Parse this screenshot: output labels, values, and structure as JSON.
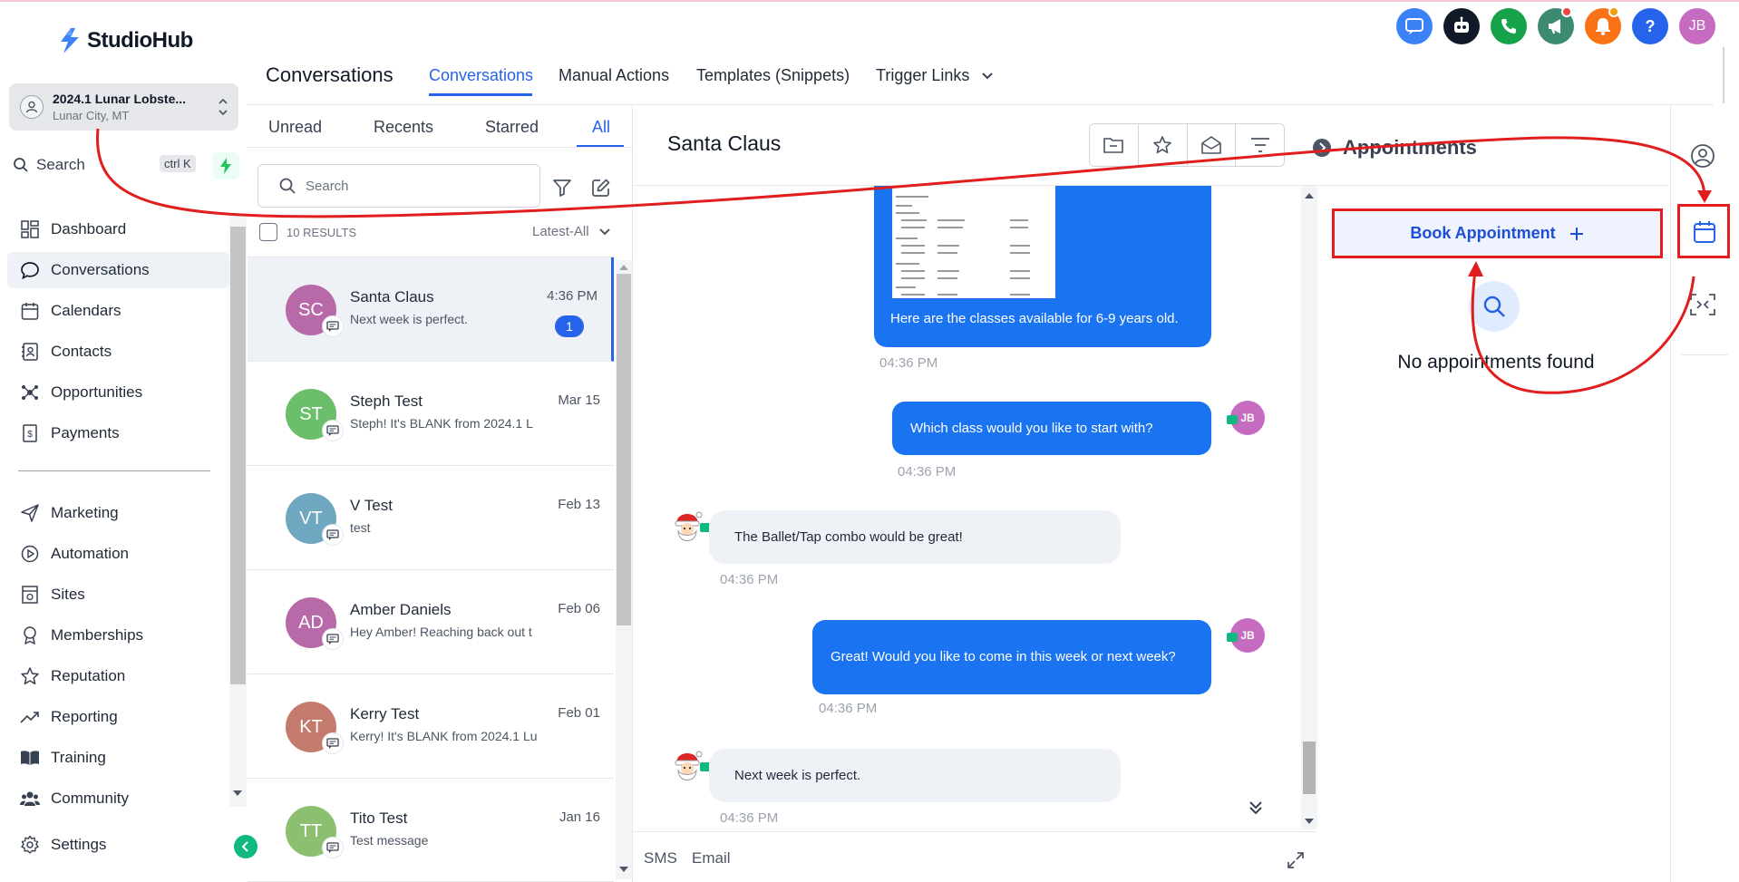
{
  "app": {
    "logo_text": "StudioHub"
  },
  "account": {
    "name": "2024.1 Lunar Lobste...",
    "location": "Lunar City, MT"
  },
  "sidebar": {
    "search_label": "Search",
    "search_shortcut": "ctrl K",
    "items": [
      {
        "label": "Dashboard",
        "icon": "dashboard-icon"
      },
      {
        "label": "Conversations",
        "icon": "chat-icon",
        "active": true
      },
      {
        "label": "Calendars",
        "icon": "calendar-icon"
      },
      {
        "label": "Contacts",
        "icon": "contacts-icon"
      },
      {
        "label": "Opportunities",
        "icon": "opportunities-icon"
      },
      {
        "label": "Payments",
        "icon": "payments-icon"
      },
      {
        "label": "Marketing",
        "icon": "send-icon"
      },
      {
        "label": "Automation",
        "icon": "automation-icon"
      },
      {
        "label": "Sites",
        "icon": "sites-icon"
      },
      {
        "label": "Memberships",
        "icon": "memberships-icon"
      },
      {
        "label": "Reputation",
        "icon": "star-icon"
      },
      {
        "label": "Reporting",
        "icon": "trend-icon"
      },
      {
        "label": "Training",
        "icon": "book-icon"
      },
      {
        "label": "Community",
        "icon": "users-icon"
      },
      {
        "label": "Settings",
        "icon": "gear-icon"
      }
    ]
  },
  "header": {
    "title": "Conversations",
    "tabs": [
      "Conversations",
      "Manual Actions",
      "Templates (Snippets)",
      "Trigger Links"
    ],
    "user_initials": "JB"
  },
  "list": {
    "filters": [
      "Unread",
      "Recents",
      "Starred",
      "All"
    ],
    "search_placeholder": "Search",
    "results": "10 RESULTS",
    "sort": "Latest-All",
    "conversations": [
      {
        "initials": "SC",
        "name": "Santa Claus",
        "preview": "Next week is perfect.",
        "time": "4:36 PM",
        "unread": "1",
        "color": "#b86aa8"
      },
      {
        "initials": "ST",
        "name": "Steph Test",
        "preview": "Steph! It's BLANK from 2024.1 L",
        "time": "Mar 15",
        "color": "#6cbf6a"
      },
      {
        "initials": "VT",
        "name": "V Test",
        "preview": "test",
        "time": "Feb 13",
        "color": "#6fa7c0"
      },
      {
        "initials": "AD",
        "name": "Amber Daniels",
        "preview": "Hey Amber! Reaching back out t",
        "time": "Feb 06",
        "color": "#b86aa8"
      },
      {
        "initials": "KT",
        "name": "Kerry Test",
        "preview": "Kerry! It's BLANK from 2024.1 Lu",
        "time": "Feb 01",
        "color": "#c47a6c"
      },
      {
        "initials": "TT",
        "name": "Tito Test",
        "preview": "Test message",
        "time": "Jan 16",
        "color": "#8cc070"
      }
    ]
  },
  "chat": {
    "contact_name": "Santa Claus",
    "messages": [
      {
        "dir": "out",
        "text": "Here are the classes available for 6-9 years old.",
        "time": "04:36 PM"
      },
      {
        "dir": "out",
        "text": "Which class would you like to start with?",
        "time": "04:36 PM",
        "avatar": "JB"
      },
      {
        "dir": "in",
        "text": "The Ballet/Tap combo would be great!",
        "time": "04:36 PM"
      },
      {
        "dir": "out",
        "text": "Great! Would you like to come in this week or next week?",
        "time": "04:36 PM",
        "avatar": "JB"
      },
      {
        "dir": "in",
        "text": "Next week is perfect.",
        "time": "04:36 PM"
      }
    ],
    "compose_tabs": [
      "SMS",
      "Email"
    ]
  },
  "appointments": {
    "title": "Appointments",
    "book_label": "Book Appointment",
    "empty_text": "No appointments found"
  },
  "colors": {
    "accent": "#2563eb",
    "annotation_red": "#e11d1d",
    "bubble_blue": "#1a73f0"
  }
}
